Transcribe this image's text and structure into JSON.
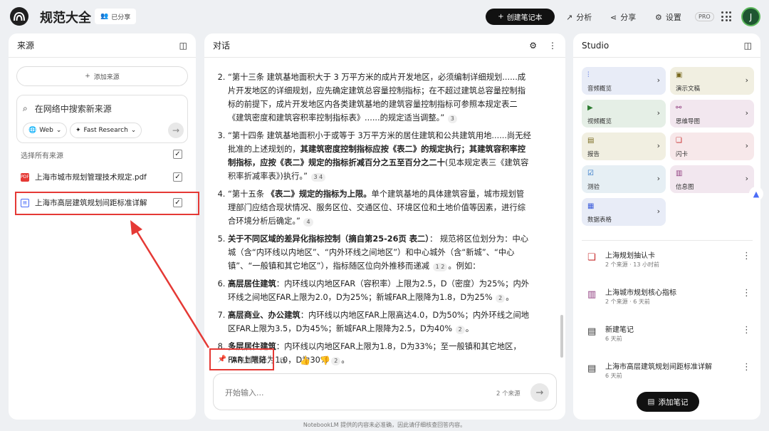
{
  "header": {
    "title": "规范大全",
    "shared_label": "已分享",
    "create_label": "创建笔记本",
    "analyze_label": "分析",
    "share_label": "分享",
    "settings_label": "设置",
    "pro_badge": "PRO",
    "avatar_initial": "J"
  },
  "sources": {
    "title": "来源",
    "add_label": "添加来源",
    "search_placeholder": "在网络中搜索新来源",
    "web_label": "Web",
    "research_label": "Fast Research",
    "select_all": "选择所有来源",
    "items": [
      {
        "name": "上海市城市规划管理技术规定.pdf",
        "icon": "PDF"
      },
      {
        "name": "上海市高层建筑规划间距标准详解",
        "icon": "doc"
      }
    ]
  },
  "chat": {
    "title": "对话",
    "items": [
      {
        "num": "2.",
        "text": "“第十三条 建筑基地面积大于 3 万平方米的成片开发地区，必须编制详细规划......成片开发地区的详细规划，应先确定建筑总容量控制指标；在不超过建筑总容量控制指标的前提下，成片开发地区内各类建筑基地的建筑容量控制指标可参照本规定表二《建筑密度和建筑容积率控制指标表》......的规定适当调整。”",
        "refs": "3"
      },
      {
        "num": "3.",
        "text_a": "“第十四条 建筑基地面积小于或等于 3万平方米的居住建筑和公共建筑用地......尚无经批准的上述规划的，",
        "bold": "其建筑密度控制指标应按《表二》的规定执行；其建筑容积率控制指标，应按《表二》规定的指标折减百分之五至百分之二十",
        "text_b": "(见本规定表三《建筑容积率折减率表》)执行。”",
        "refs": "3 4"
      },
      {
        "num": "4.",
        "text_a": "“第十五条 ",
        "bold": "《表二》规定的指标为上限。",
        "text_b": "单个建筑基地的具体建筑容量，城市规划管理部门应结合现状情况、服务区位、交通区位、环境区位和土地价值等因素，进行综合环境分析后确定。”",
        "refs": "4"
      },
      {
        "num": "5.",
        "bold": "关于不同区域的差异化指标控制（摘自第25-26页 表二）",
        "text_b": "： 规范将区位划分为：中心城（含“内环线以内地区”、“内外环线之间地区”）和中心城外（含“新城”、“中心镇”、“一般镇和其它地区”），指标随区位向外推移而递减",
        "refs": "1 2",
        "tail": "。例如："
      },
      {
        "num": "6.",
        "bold": "高层居住建筑",
        "text_b": "：内环线以内地区FAR（容积率）上限为2.5，D（密度）为25%；内外环线之间地区FAR上限为2.0，D为25%；新城FAR上限降为1.8，D为25%",
        "refs": "2",
        "tail": "。"
      },
      {
        "num": "7.",
        "bold": "高层商业、办公建筑",
        "text_b": "：内环线以内地区FAR上限高达4.0，D为50%；内外环线之间地区FAR上限为3.5，D为45%；新城FAR上限降为2.5，D为40%",
        "refs": "2",
        "tail": "。"
      },
      {
        "num": "8.",
        "bold": "多层居住建筑",
        "text_b": "：内环线以内地区FAR上限为1.8，D为33%；至一般镇和其它地区，FAR上限降为1.0，D为30%",
        "refs": "2",
        "tail": "。"
      }
    ],
    "save_label": "保存到笔记",
    "input_placeholder": "开始输入...",
    "source_count": "2 个来源"
  },
  "studio": {
    "title": "Studio",
    "tiles": [
      {
        "label": "音频概览",
        "icon": "audio-icon",
        "color": "#e8ecf7"
      },
      {
        "label": "演示文稿",
        "icon": "slides-icon",
        "color": "#f1efe1"
      },
      {
        "label": "视频概览",
        "icon": "video-icon",
        "color": "#e5efe6"
      },
      {
        "label": "思维导图",
        "icon": "mindmap-icon",
        "color": "#f2e7ef"
      },
      {
        "label": "报告",
        "icon": "report-icon",
        "color": "#f1efe1"
      },
      {
        "label": "闪卡",
        "icon": "flashcard-icon",
        "color": "#f7e8ea"
      },
      {
        "label": "测验",
        "icon": "quiz-icon",
        "color": "#e6eff4"
      },
      {
        "label": "信息图",
        "icon": "infographic-icon",
        "color": "#f2e7ef"
      },
      {
        "label": "数据表格",
        "icon": "table-icon",
        "color": "#e8ecf7"
      }
    ],
    "notes": [
      {
        "title": "上海规划抽认卡",
        "meta": "2 个来源 · 13 小时前",
        "icon": "flashcard-icon"
      },
      {
        "title": "上海城市规划核心指标",
        "meta": "2 个来源 · 6 天前",
        "icon": "chart-icon"
      },
      {
        "title": "新建笔记",
        "meta": "6 天前",
        "icon": "note-icon"
      },
      {
        "title": "上海市高层建筑规划间距标准详解",
        "meta": "6 天前",
        "icon": "note-icon"
      }
    ],
    "add_note_label": "添加笔记"
  },
  "footer": "NotebookLM 提供的内容未必准确，因此请仔细核查回答内容。"
}
